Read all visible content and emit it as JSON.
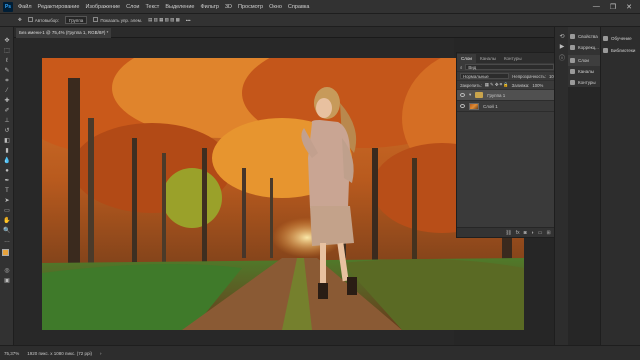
{
  "menubar": {
    "logo": "Ps",
    "items": [
      "Файл",
      "Редактирование",
      "Изображение",
      "Слои",
      "Текст",
      "Выделение",
      "Фильтр",
      "3D",
      "Просмотр",
      "Окно",
      "Справка"
    ],
    "controls": [
      "—",
      "❐",
      "✕"
    ]
  },
  "options": {
    "autoselect_label": "Автовыбор:",
    "autoselect_value": "Группа",
    "transform_label": "Показать упр. элем."
  },
  "document": {
    "tab_title": "Без имени-1 @ 75,4% (Группа 1, RGB/8#) *",
    "status_zoom": "75,37%",
    "status_size": "1920 пикс. x 1080 пикс. (72 ppi)"
  },
  "layers_panel": {
    "tabs": [
      "Слои",
      "Каналы",
      "Контуры"
    ],
    "filter_label": "Вид",
    "blend_mode": "Нормальные",
    "opacity_label": "Непрозрачность:",
    "opacity_value": "100%",
    "lock_label": "Закрепить:",
    "fill_label": "Заливка:",
    "fill_value": "100%",
    "layers": [
      {
        "name": "Группа 1",
        "type": "group"
      },
      {
        "name": "Слой 1",
        "type": "image"
      }
    ],
    "bottom_icons": [
      "link-icon",
      "fx-icon",
      "mask-icon",
      "adjustment-icon",
      "folder-icon",
      "new-layer-icon",
      "trash-icon"
    ]
  },
  "dock": {
    "items": [
      {
        "label": "Свойства",
        "icon": "properties-icon"
      },
      {
        "label": "Коррекц...",
        "icon": "adjustments-icon"
      },
      {
        "label": "Слои",
        "icon": "layers-icon"
      },
      {
        "label": "Каналы",
        "icon": "channels-icon"
      },
      {
        "label": "Контуры",
        "icon": "paths-icon"
      }
    ],
    "right": [
      {
        "label": "Обучение",
        "icon": "learn-icon"
      },
      {
        "label": "Библиотеки",
        "icon": "libraries-icon"
      }
    ]
  },
  "colors": {
    "foreground": "#e8a33b",
    "background": "#000000",
    "accent": "#31a8ff"
  }
}
